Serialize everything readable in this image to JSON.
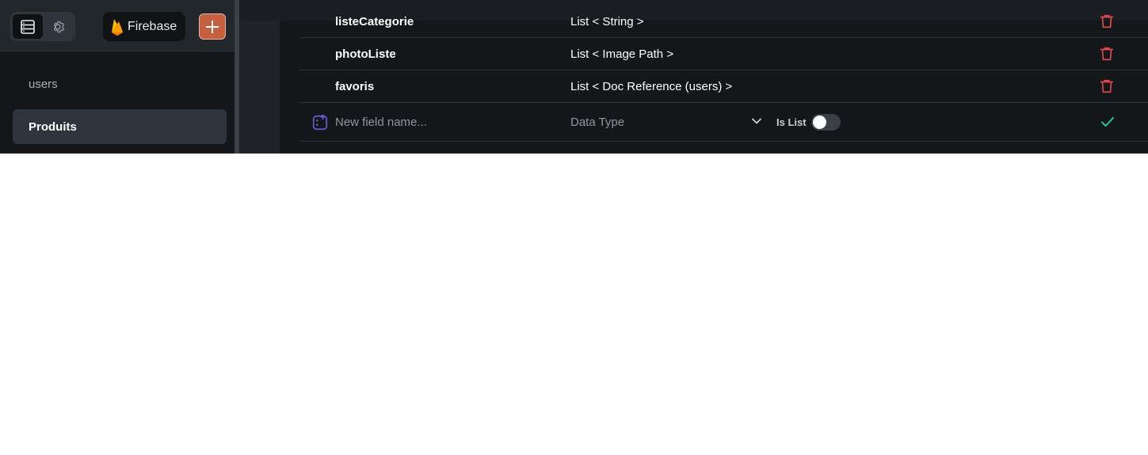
{
  "sidebar": {
    "firebase_label": "Firebase",
    "collections": [
      {
        "label": "users",
        "selected": false
      },
      {
        "label": "Produits",
        "selected": true
      }
    ]
  },
  "fields": {
    "rows": [
      {
        "name": "listeCategorie",
        "type": "List < String >"
      },
      {
        "name": "photoListe",
        "type": "List < Image Path >"
      },
      {
        "name": "favoris",
        "type": "List < Doc Reference (users) >"
      }
    ],
    "new_field": {
      "name_placeholder": "New field name...",
      "type_placeholder": "Data Type",
      "is_list_label": "Is List",
      "is_list_value": false
    }
  },
  "colors": {
    "accent_orange": "#c65f3f",
    "delete_red": "#e5484d",
    "confirm_green": "#2fbf9b",
    "add_icon_purple": "#6b5bd6"
  },
  "icons": {
    "database": "database-icon",
    "settings": "gear-icon",
    "firebase": "firebase-flame-icon",
    "add": "plus-icon",
    "delete": "trash-icon",
    "new_field": "add-field-icon",
    "dropdown": "chevron-down-icon",
    "confirm": "check-icon"
  }
}
